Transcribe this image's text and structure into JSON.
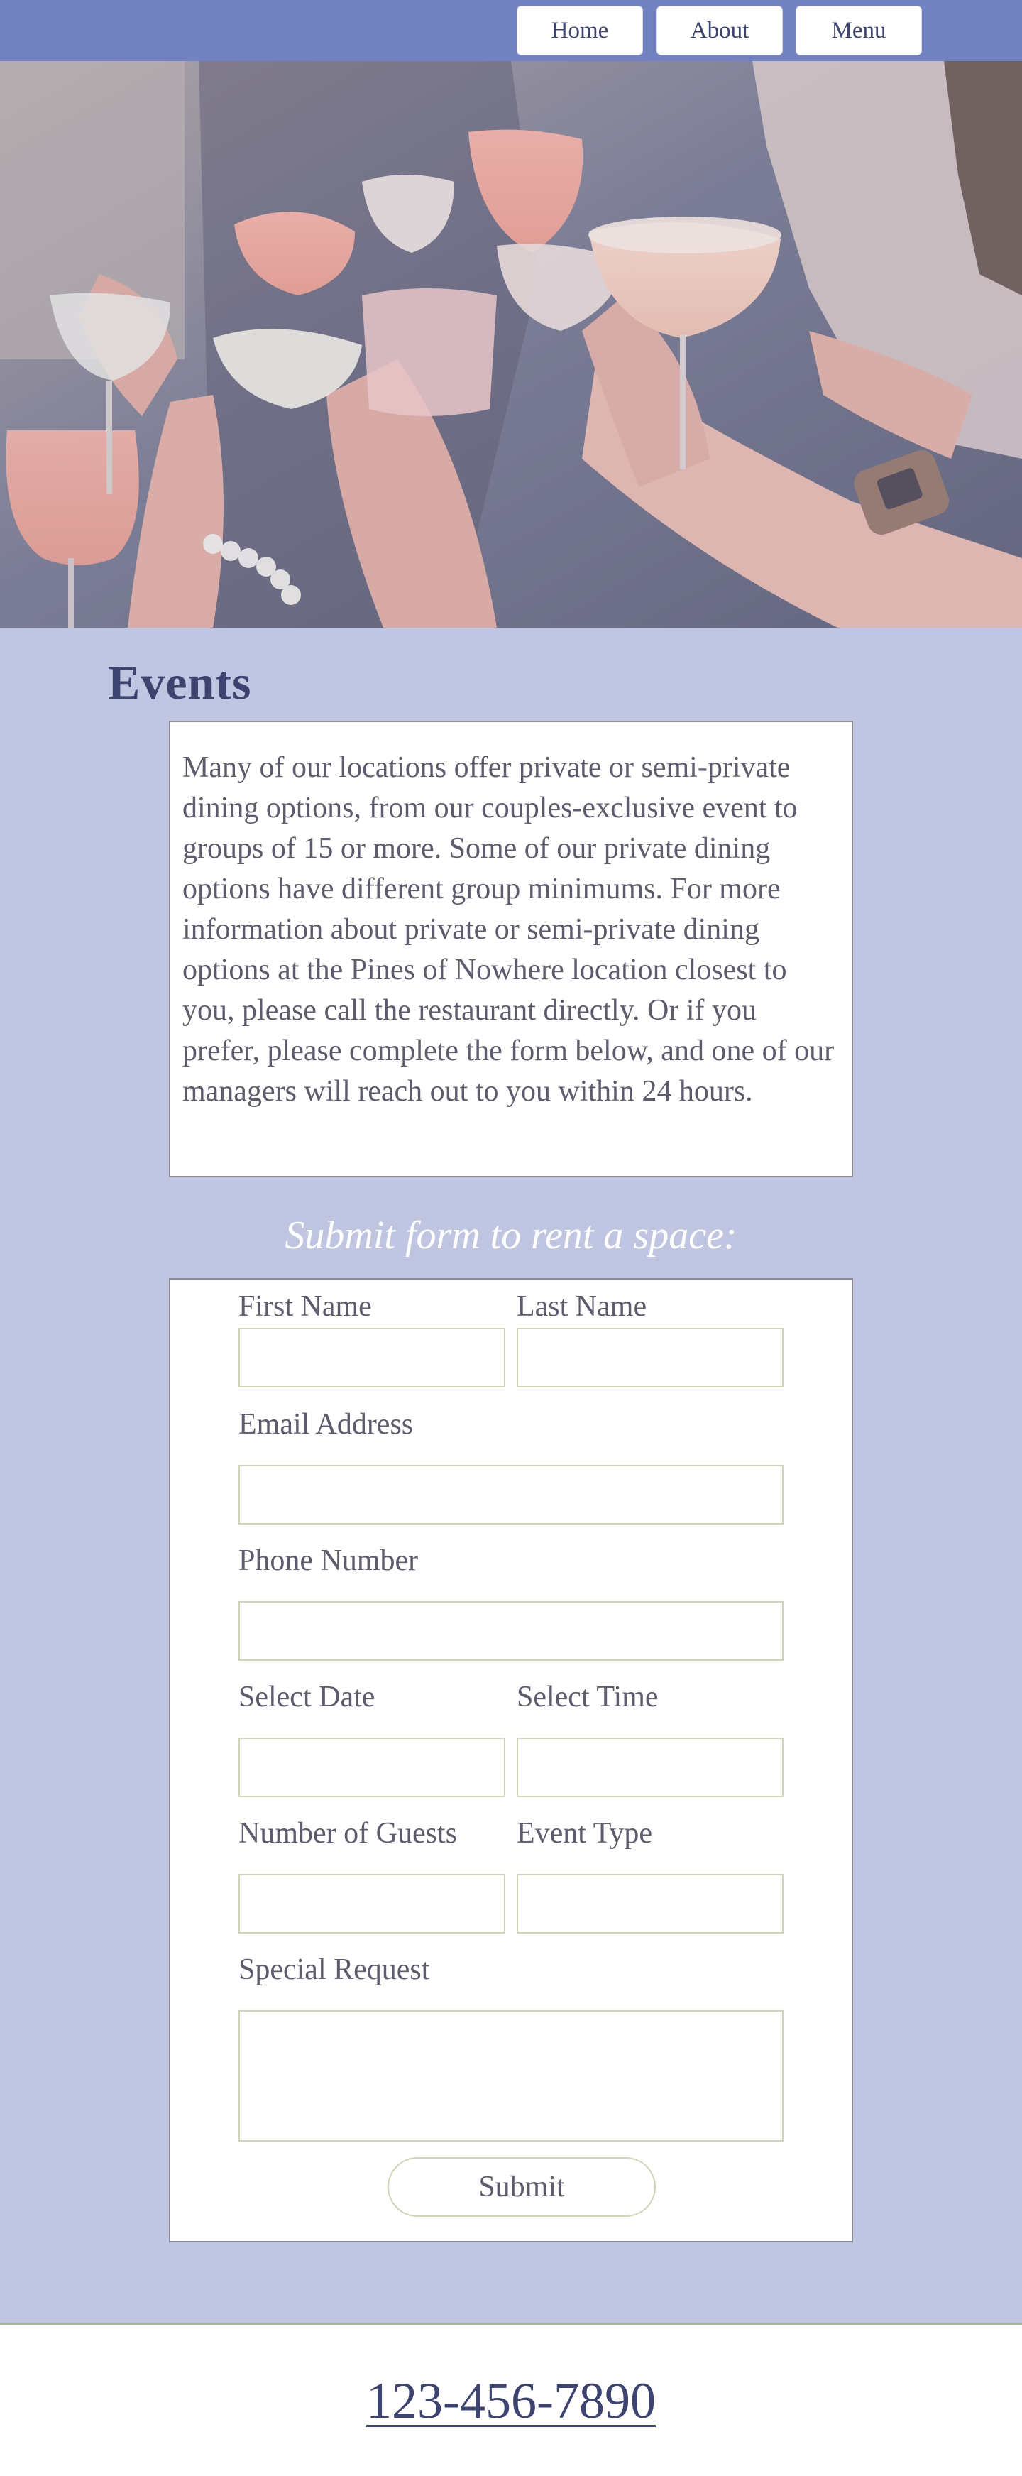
{
  "nav": {
    "items": [
      {
        "label": "Home"
      },
      {
        "label": "About"
      },
      {
        "label": "Menu"
      }
    ],
    "background": "#7281c0"
  },
  "hero": {
    "image": "people-toasting-cocktail-glasses"
  },
  "events": {
    "title": "Events",
    "intro": "Many of our locations offer private or semi-private dining options, from our couples-exclusive event to groups of 15 or more. Some of our private dining options have different group minimums. For more information about private or semi-private dining options at the Pines of Nowhere location closest to you, please call the restaurant directly. Or if you prefer, please complete the form below, and one of our managers will reach out to you within 24 hours."
  },
  "form": {
    "heading": "Submit form to rent a space:",
    "fields": {
      "first_name": {
        "label": "First Name",
        "value": ""
      },
      "last_name": {
        "label": "Last Name",
        "value": ""
      },
      "email": {
        "label": "Email Address",
        "value": ""
      },
      "phone": {
        "label": "Phone Number",
        "value": ""
      },
      "date": {
        "label": "Select Date",
        "value": ""
      },
      "time": {
        "label": "Select Time",
        "value": ""
      },
      "guests": {
        "label": "Number of Guests",
        "value": ""
      },
      "event_type": {
        "label": "Event Type",
        "value": ""
      },
      "special_request": {
        "label": "Special Request",
        "value": ""
      }
    },
    "submit_label": "Submit"
  },
  "footer": {
    "phone": "123-456-7890"
  },
  "colors": {
    "page_background": "#c0c6e1",
    "accent": "#3d4470",
    "input_border": "#d3d3b8"
  }
}
